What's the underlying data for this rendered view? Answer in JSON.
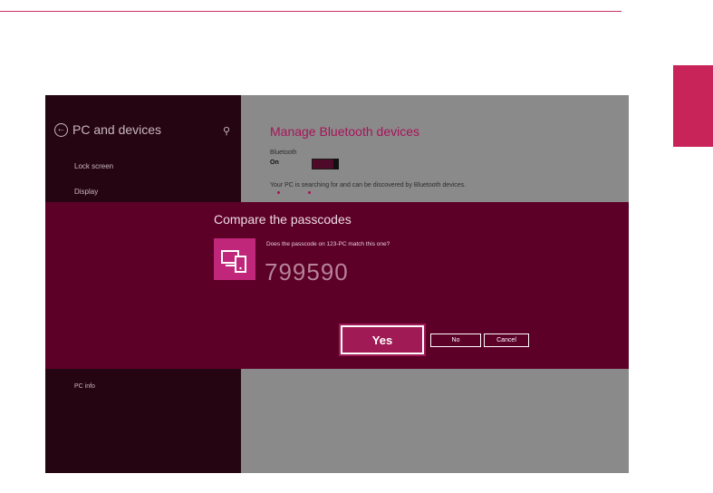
{
  "nav": {
    "title": "PC and devices",
    "items": [
      "Lock screen",
      "Display"
    ],
    "bottom_item": "PC info"
  },
  "content": {
    "title": "Manage Bluetooth devices",
    "bluetooth_label": "Bluetooth",
    "bluetooth_state": "On",
    "status": "Your PC is searching for and can be discovered by Bluetooth devices."
  },
  "dialog": {
    "title": "Compare the passcodes",
    "question": "Does the passcode on 123-PC match this one?",
    "passcode": "799590",
    "buttons": {
      "yes": "Yes",
      "no": "No",
      "cancel": "Cancel"
    }
  },
  "icons": {
    "back": "back-arrow-icon",
    "search": "search-icon",
    "device": "devices-icon"
  },
  "colors": {
    "accent": "#c8245a",
    "dialog_bg": "#5c0028",
    "nav_bg": "#260512",
    "title_accent": "#a8135a"
  }
}
